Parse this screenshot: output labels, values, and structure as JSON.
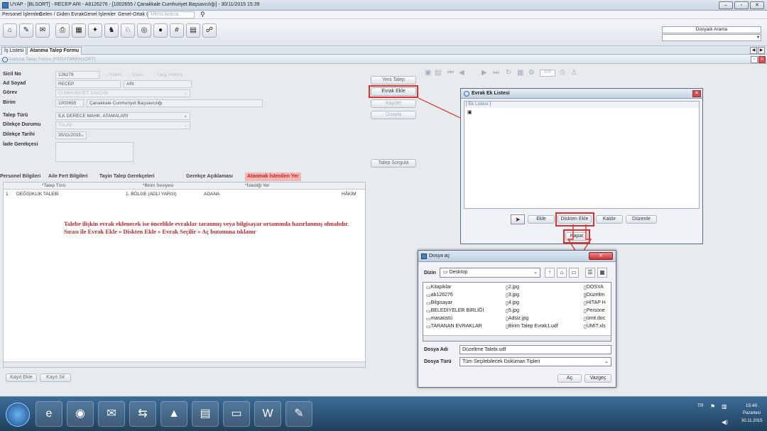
{
  "window": {
    "title": "UYAP - [BLSORT] - RECEP ARI - A8126276 - [1002655 / Çanakkale Cumhuriyet Başsavcılığı] - 30/11/2015 15:39"
  },
  "menu": {
    "items": [
      "Personel İşlemleri",
      "Gelen / Giden Evrak",
      "Genel İşlemler",
      "Genel-Ortak (X)"
    ],
    "search_placeholder": "Menu Arama"
  },
  "top_search": {
    "label": "Dosyadı Arama"
  },
  "tabs": [
    "İş Listesi",
    "Atanma Talep Formu"
  ],
  "form_header": "Atanma Talep Formu (PERATMM041ORT)",
  "form": {
    "sicil_label": "Sicil No",
    "sicil": "126276",
    "hakim": "Hakim",
    "savci": "Savcı",
    "yargi": "Yargı Hakimi",
    "adsoyad_label": "Ad Soyad",
    "ad": "RECEP",
    "soyad": "ARI",
    "gorev_label": "Görev",
    "gorev": "CUMHURİYET SAVCISI",
    "birim_label": "Birim",
    "birim_kod": "1002655",
    "birim_ad": "Çanakkale Cumhuriyet Başsavcılığı",
    "talep_turu_label": "Talep Türü",
    "talep_turu": "İLK DERECE MAHK. ATAMALARI",
    "dilekce_durumu_label": "Dilekçe Durumu",
    "dilekce_durumu": "TALEP",
    "dilekce_tarihi_label": "Dilekçe Tarihi",
    "dilekce_tarihi": "30/11/2015",
    "iade_label": "İade Gerekçesi"
  },
  "side_buttons": {
    "yeni": "Yeni Talep",
    "evrak_ekle": "Evrak Ekle",
    "kaydet": "Kaydet",
    "onayla": "Onayla",
    "sorgula": "Talep Sorgula"
  },
  "panel_tabs": [
    "Personel Bilgileri",
    "Aile Fert Bilgileri",
    "Tayin Talep Gerekçeleri",
    "Gerekçe Açıklaması",
    "Atanmak İstenilen Yer"
  ],
  "grid": {
    "headers": [
      "*Talep Türü",
      "*Birim Seviyesi",
      "*İstediği Yer"
    ],
    "row": {
      "no": "1",
      "tur": "DEĞİŞİKLİK TALEBİ",
      "seviye": "1. BÖLGE (ADLİ YARGI)",
      "yer": "ADANA",
      "unvan": "HÂKİM"
    }
  },
  "instruction": [
    "Talebe ilişkin evrak eklenecek ise öncelikle evraklar taranmış veya bilgisayar ortamında hazırlanmış olmalıdır.",
    "Sırası ile Evrak Ekle » Diskten Ekle » Evrak Seçilir » Aç butonuna tıklanır"
  ],
  "bottom_buttons": {
    "kayit_ekle": "Kayıt Ekle",
    "kayit_sil": "Kayıt Sil"
  },
  "viewer": {
    "zoom": "100"
  },
  "ek_dialog": {
    "title": "Evrak Ek Listesi",
    "list_label": "[ Ek Listesi ]",
    "ekle": "Ekle",
    "diskten": "Diskten Ekle",
    "kaldir": "Kaldır",
    "duzenle": "Düzenle",
    "kapat": "Kapat"
  },
  "file_dialog": {
    "title": "Dosya aç",
    "dizin_label": "Dizin",
    "dizin": "Desktop",
    "col1": [
      "Kitapiklar",
      "ab126276",
      "Bilgisayar",
      "BELEDİYELER BİRLİĞİ",
      "masaüstü",
      "TARANAN EVRAKLAR"
    ],
    "col2": [
      "2.jpg",
      "3.jpg",
      "4.jpg",
      "5.jpg",
      "Adsiz.jpg",
      "Birim Talep Evrak1.udf"
    ],
    "col3": [
      "DOSYA",
      "Düzeltm",
      "HİTAP H",
      "Persone",
      "ümit.doc",
      "ÜMİT.xls"
    ],
    "ad_label": "Dosya Adı",
    "ad": "Düzeltme Talebi.udf",
    "tur_label": "Dosya Türü",
    "tur": "Tüm Seçilebilecek Doküman Tipleri",
    "ac": "Aç",
    "vazgec": "Vazgeç"
  },
  "tray": {
    "lang": "TR",
    "time": "15:40",
    "day": "Pazartesi",
    "date": "30.11.2015"
  },
  "colors": {
    "highlight": "#e03030",
    "instruction": "#c0282d"
  }
}
